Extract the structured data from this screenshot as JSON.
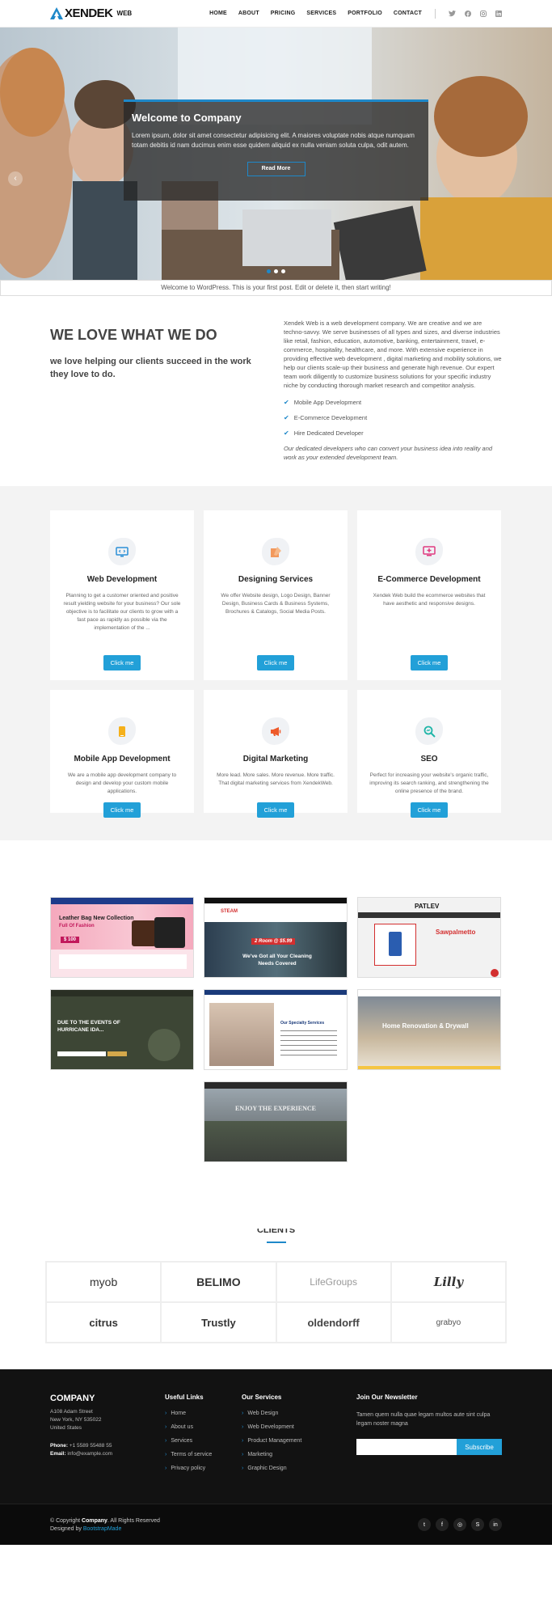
{
  "header": {
    "logo_text": "XENDEK",
    "logo_sub": "WEB",
    "nav": [
      {
        "label": "HOME"
      },
      {
        "label": "ABOUT"
      },
      {
        "label": "PRICING"
      },
      {
        "label": "SERVICES"
      },
      {
        "label": "PORTFOLIO"
      },
      {
        "label": "CONTACT"
      }
    ],
    "social_icons": [
      "twitter-icon",
      "facebook-icon",
      "instagram-icon",
      "linkedin-icon"
    ]
  },
  "hero": {
    "title": "Welcome to Company",
    "text": "Lorem ipsum, dolor sit amet consectetur adipisicing elit. A maiores voluptate nobis atque numquam totam debitis id nam ducimus enim esse quidem aliquid ex nulla veniam soluta culpa, odit autem.",
    "button": "Read More",
    "active_slide": 1,
    "slide_count": 3
  },
  "notice": "Welcome to WordPress. This is your first post. Edit or delete it, then start writing!",
  "about": {
    "heading": "WE LOVE WHAT WE DO",
    "subheading": "we love helping our clients succeed in the work they love to do.",
    "paragraph": "Xendek Web is a web development company. We are creative and we are techno-savvy. We serve businesses of all types and sizes, and diverse industries like retail, fashion, education, automotive, banking, entertainment, travel, e-commerce, hospitality, healthcare, and more. With extensive experience in providing effective web development , digital marketing and mobility solutions, we help our clients scale-up their business and generate high revenue. Our expert team work diligently to customize business solutions for your specific industry niche by conducting thorough market research and competitor analysis.",
    "list": [
      "Mobile App Development",
      "E-Commerce Development",
      "Hire Dedicated Developer"
    ],
    "note": "Our dedicated developers who can convert your business idea into reality and work as your extended development team."
  },
  "services": [
    {
      "title": "Web Development",
      "text": "Planning to get a customer oriented and positive result yielding website for your business? Our sole objective is to facilitate our clients to grow with a fast pace as rapidly as possible via the implementation of the ...",
      "button": "Click me",
      "icon": "monitor-code-icon",
      "color": "#2a8fd6"
    },
    {
      "title": "Designing Services",
      "text": "We offer Website design, Logo Design, Banner Design, Business Cards & Business Systems, Brochures & Catalogs, Social Media Posts.",
      "button": "Click me",
      "icon": "design-brush-icon",
      "color": "#f2995d"
    },
    {
      "title": "E-Commerce Development",
      "text": "Xendek Web build the ecommerce websites that have aesthetic and responsive designs.",
      "button": "Click me",
      "icon": "shop-screen-icon",
      "color": "#e03a80"
    },
    {
      "title": "Mobile App Development",
      "text": "We are a mobile app development company to design and develop your custom mobile applications.",
      "button": "Click me",
      "icon": "mobile-phone-icon",
      "color": "#f5b01a"
    },
    {
      "title": "Digital Marketing",
      "text": "More lead. More sales. More revenue. More traffic. That digital marketing services from XendekWeb.",
      "button": "Click me",
      "icon": "megaphone-icon",
      "color": "#ee5a2a"
    },
    {
      "title": "SEO",
      "text": "Perfect for increasing your website's organic traffic, improving its search ranking, and strengthening the online presence of the brand.",
      "button": "Click me",
      "icon": "seo-magnifier-icon",
      "color": "#1fb5a8"
    }
  ],
  "portfolio": [
    {
      "caption": "Leather Bag New Collection",
      "sub": "Full Of Fashion",
      "price": "$ 100"
    },
    {
      "caption": "We've Got all Your Cleaning Needs Covered",
      "sub": "2 Room @ $5.99",
      "brand": "STEAM"
    },
    {
      "caption": "Sawpalmetto",
      "brand": "PATLEV"
    },
    {
      "caption": "DUE TO THE EVENTS OF HURRICANE IDA..."
    },
    {
      "caption": "Our Specialty Services"
    },
    {
      "caption": "Home Renovation & Drywall"
    },
    {
      "caption": "ENJOY THE EXPERIENCE"
    }
  ],
  "clients": {
    "title": "CLIENTS",
    "logos": [
      "myob",
      "BELIMO",
      "LifeGroups",
      "Lilly",
      "citrus",
      "Trustly",
      "oldendorff",
      "grabyo"
    ]
  },
  "footer": {
    "company": "COMPANY",
    "address": [
      "A108 Adam Street",
      "New York, NY 535022",
      "United States"
    ],
    "phone_label": "Phone:",
    "phone": "+1 5589 55488 55",
    "email_label": "Email:",
    "email": "info@example.com",
    "useful_links_title": "Useful Links",
    "useful_links": [
      "Home",
      "About us",
      "Services",
      "Terms of service",
      "Privacy policy"
    ],
    "services_title": "Our Services",
    "services_links": [
      "Web Design",
      "Web Development",
      "Product Management",
      "Marketing",
      "Graphic Design"
    ],
    "newsletter_title": "Join Our Newsletter",
    "newsletter_text": "Tamen quem nulla quae legam multos aute sint culpa legam noster magna",
    "subscribe": "Subscribe",
    "copyright_prefix": "© Copyright",
    "copyright_brand": "Company",
    "copyright_suffix": ". All Rights Reserved",
    "designed_prefix": "Designed by",
    "designed_by": "BootstrapMade"
  }
}
